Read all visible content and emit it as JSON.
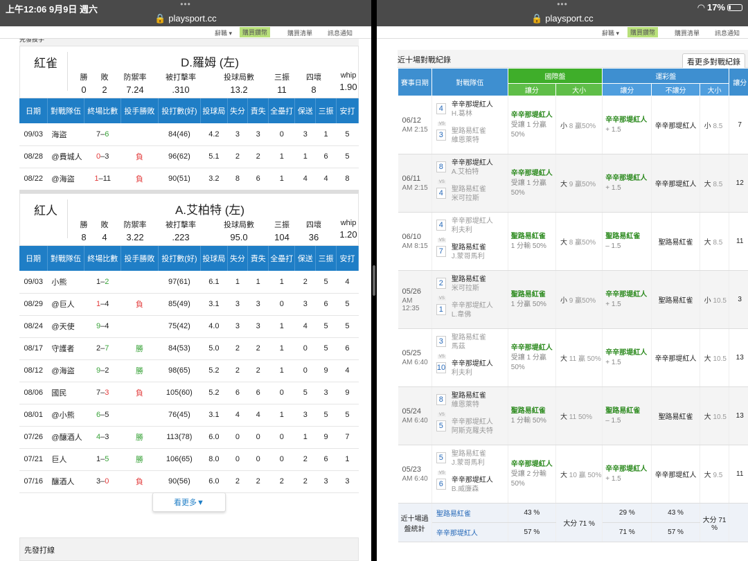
{
  "status_left": {
    "time": "上午12:06",
    "date": "9月9日 週六",
    "url": "playsport.cc"
  },
  "status_right": {
    "url": "playsport.cc",
    "battery": "17%"
  },
  "sitebar": {
    "items": [
      "辭職 ▾",
      "購買鑽幣",
      "購買清單",
      "訊息通知"
    ]
  },
  "left": {
    "top_cut": "先發投手",
    "cards": [
      {
        "team": "紅雀",
        "pitcher": "D.羅姆 (左)",
        "labels": [
          "勝",
          "敗",
          "防禦率",
          "被打擊率",
          "投球局數",
          "三振",
          "四壞",
          "whip"
        ],
        "values": [
          "0",
          "2",
          "7.24",
          ".310",
          "13.2",
          "11",
          "8",
          "1.90"
        ],
        "headers": [
          "日期",
          "對戰隊伍",
          "終場比數",
          "投手勝敗",
          "投打數(好)",
          "投球局",
          "失分",
          "責失",
          "全壘打",
          "保送",
          "三振",
          "安打"
        ],
        "rows": [
          [
            "09/03",
            "海盜",
            "7–",
            "6",
            "",
            "84(46)",
            "4.2",
            "3",
            "3",
            "0",
            "3",
            "1",
            "5"
          ],
          [
            "08/28",
            "@費城人",
            "0",
            "–3",
            "負",
            "96(62)",
            "5.1",
            "2",
            "2",
            "1",
            "1",
            "6",
            "5"
          ],
          [
            "08/22",
            "@海盜",
            "1",
            "–11",
            "負",
            "90(51)",
            "3.2",
            "8",
            "6",
            "1",
            "4",
            "4",
            "8"
          ]
        ]
      },
      {
        "team": "紅人",
        "pitcher": "A.艾柏特 (左)",
        "labels": [
          "勝",
          "敗",
          "防禦率",
          "被打擊率",
          "投球局數",
          "三振",
          "四壞",
          "whip"
        ],
        "values": [
          "8",
          "4",
          "3.22",
          ".223",
          "95.0",
          "104",
          "36",
          "1.20"
        ],
        "headers": [
          "日期",
          "對戰隊伍",
          "終場比數",
          "投手勝敗",
          "投打數(好)",
          "投球局",
          "失分",
          "責失",
          "全壘打",
          "保送",
          "三振",
          "安打"
        ],
        "rows": [
          [
            "09/03",
            "小熊",
            "1–",
            "2",
            "",
            "97(61)",
            "6.1",
            "1",
            "1",
            "1",
            "2",
            "5",
            "4"
          ],
          [
            "08/29",
            "@巨人",
            "1",
            "–4",
            "負",
            "85(49)",
            "3.1",
            "3",
            "3",
            "0",
            "3",
            "6",
            "5"
          ],
          [
            "08/24",
            "@天使",
            "9",
            "–4",
            "",
            "75(42)",
            "4.0",
            "3",
            "3",
            "1",
            "4",
            "5",
            "5"
          ],
          [
            "08/17",
            "守護者",
            "2–",
            "7",
            "勝",
            "84(53)",
            "5.0",
            "2",
            "2",
            "1",
            "0",
            "5",
            "6"
          ],
          [
            "08/12",
            "@海盜",
            "9",
            "–2",
            "勝",
            "98(65)",
            "5.2",
            "2",
            "2",
            "1",
            "0",
            "9",
            "4"
          ],
          [
            "08/06",
            "國民",
            "7–",
            "3",
            "負",
            "105(60)",
            "5.2",
            "6",
            "6",
            "0",
            "5",
            "3",
            "9"
          ],
          [
            "08/01",
            "@小熊",
            "6",
            "–5",
            "",
            "76(45)",
            "3.1",
            "4",
            "4",
            "1",
            "3",
            "5",
            "5"
          ],
          [
            "07/26",
            "@釀酒人",
            "4",
            "–3",
            "勝",
            "113(78)",
            "6.0",
            "0",
            "0",
            "0",
            "1",
            "9",
            "7"
          ],
          [
            "07/21",
            "巨人",
            "1–",
            "5",
            "勝",
            "106(65)",
            "8.0",
            "0",
            "0",
            "0",
            "2",
            "6",
            "1"
          ],
          [
            "07/16",
            "釀酒人",
            "3–",
            "0",
            "負",
            "90(56)",
            "6.0",
            "2",
            "2",
            "2",
            "2",
            "3",
            "3"
          ]
        ]
      }
    ],
    "more": "看更多▼",
    "bottom": "先發打線"
  },
  "right": {
    "title": "近十場對戰紀錄",
    "more_btn": "看更多對戰紀錄",
    "h1": [
      "賽事日期",
      "對戰隊伍",
      "國際盤",
      "運彩盤",
      "讓分"
    ],
    "h2": [
      "讓分",
      "大小",
      "讓分",
      "不讓分",
      "大小"
    ],
    "games": [
      {
        "date": "06/12",
        "time": "AM 2:15",
        "s1": "4",
        "t1": "辛辛那堤紅人",
        "p1": "H.葛林",
        "s2": "3",
        "t2": "聖路易紅雀",
        "p2": "維恩萊特",
        "win": 1,
        "i_team": "辛辛那堤紅人",
        "i_sub": "受讓 1 分贏 50%",
        "ou_a": "小",
        "ou_b": "8",
        "ou_c": "贏50%",
        "l_team": "辛辛那堤紅人",
        "l_sub": "+ 1.5",
        "nr": "辛辛那堤紅人",
        "lou_a": "小",
        "lou_b": "8.5",
        "last": "7"
      },
      {
        "date": "06/11",
        "time": "AM 2:15",
        "s1": "8",
        "t1": "辛辛那堤紅人",
        "p1": "A.艾柏特",
        "s2": "4",
        "t2": "聖路易紅雀",
        "p2": "米可拉斯",
        "win": 1,
        "i_team": "辛辛那堤紅人",
        "i_sub": "受讓 1 分贏 50%",
        "ou_a": "大",
        "ou_b": "9",
        "ou_c": "贏50%",
        "l_team": "辛辛那堤紅人",
        "l_sub": "+ 1.5",
        "nr": "辛辛那堤紅人",
        "lou_a": "大",
        "lou_b": "8.5",
        "last": "12"
      },
      {
        "date": "06/10",
        "time": "AM 8:15",
        "s1": "4",
        "t1": "辛辛那堤紅人",
        "p1": "利夫利",
        "s2": "7",
        "t2": "聖路易紅雀",
        "p2": "J.蒙哥馬利",
        "win": 2,
        "i_team": "聖路易紅雀",
        "i_sub": "1 分輸 50%",
        "ou_a": "大",
        "ou_b": "8",
        "ou_c": "贏50%",
        "l_team": "聖路易紅雀",
        "l_sub": "– 1.5",
        "nr": "聖路易紅雀",
        "lou_a": "大",
        "lou_b": "8.5",
        "last": "11"
      },
      {
        "date": "05/26",
        "time": "AM 12:35",
        "s1": "2",
        "t1": "聖路易紅雀",
        "p1": "米可拉斯",
        "s2": "1",
        "t2": "辛辛那堤紅人",
        "p2": "L.韋佛",
        "win": 1,
        "i_team": "聖路易紅雀",
        "i_sub": "1 分贏 50%",
        "ou_a": "小",
        "ou_b": "9",
        "ou_c": "贏50%",
        "l_team": "辛辛那堤紅人",
        "l_sub": "+ 1.5",
        "nr": "聖路易紅雀",
        "lou_a": "小",
        "lou_b": "10.5",
        "last": "3"
      },
      {
        "date": "05/25",
        "time": "AM 6:40",
        "s1": "3",
        "t1": "聖路易紅雀",
        "p1": "馬茲",
        "s2": "10",
        "t2": "辛辛那堤紅人",
        "p2": "利夫利",
        "win": 2,
        "i_team": "辛辛那堤紅人",
        "i_sub": "受讓 1 分贏 50%",
        "ou_a": "大",
        "ou_b": "11",
        "ou_c": "贏 50%",
        "l_team": "辛辛那堤紅人",
        "l_sub": "+ 1.5",
        "nr": "辛辛那堤紅人",
        "lou_a": "大",
        "lou_b": "10.5",
        "last": "13"
      },
      {
        "date": "05/24",
        "time": "AM 6:40",
        "s1": "8",
        "t1": "聖路易紅雀",
        "p1": "維恩萊特",
        "s2": "5",
        "t2": "辛辛那堤紅人",
        "p2": "阿斯克羅夫特",
        "win": 1,
        "i_team": "聖路易紅雀",
        "i_sub": "1 分輸 50%",
        "ou_a": "大",
        "ou_b": "11",
        "ou_c": "50%",
        "l_team": "聖路易紅雀",
        "l_sub": "– 1.5",
        "nr": "聖路易紅雀",
        "lou_a": "大",
        "lou_b": "10.5",
        "last": "13"
      },
      {
        "date": "05/23",
        "time": "AM 6:40",
        "s1": "5",
        "t1": "聖路易紅雀",
        "p1": "J.蒙哥馬利",
        "s2": "6",
        "t2": "辛辛那堤紅人",
        "p2": "B.威廉森",
        "win": 2,
        "i_team": "辛辛那堤紅人",
        "i_sub": "受讓 2 分輸 50%",
        "ou_a": "大",
        "ou_b": "10",
        "ou_c": "贏 50%",
        "l_team": "辛辛那堤紅人",
        "l_sub": "+ 1.5",
        "nr": "辛辛那堤紅人",
        "lou_a": "大",
        "lou_b": "9.5",
        "last": "11"
      }
    ],
    "summary": {
      "label": "近十場過盤統計",
      "t1": "聖路易紅雀",
      "t2": "辛辛那堤紅人",
      "i1": "43 %",
      "i2": "57 %",
      "ou": "大分 71 %",
      "l1": "29 %",
      "l2": "71 %",
      "n1": "43 %",
      "n2": "57 %",
      "lou": "大分 71 %"
    }
  }
}
